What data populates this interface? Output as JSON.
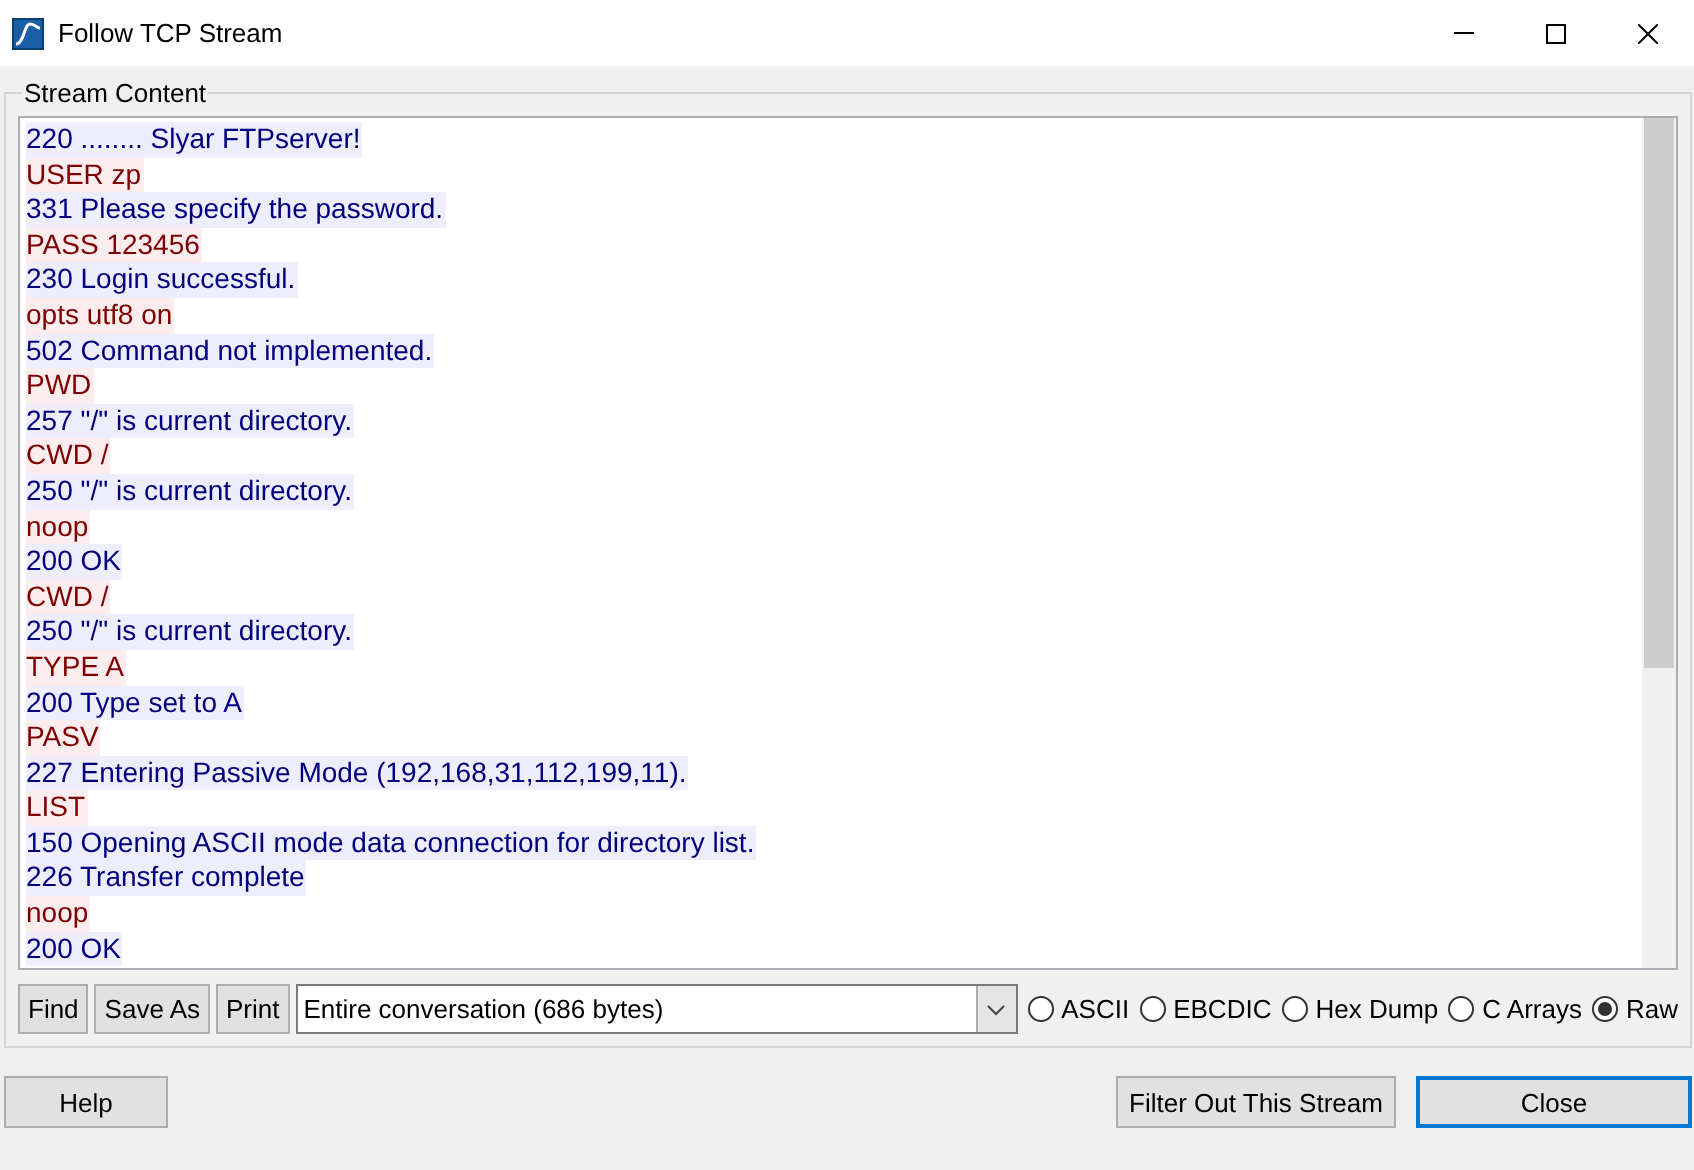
{
  "window": {
    "title": "Follow TCP Stream"
  },
  "stream": {
    "label": "Stream Content",
    "lines": [
      {
        "kind": "server",
        "text": "220 ........ Slyar FTPserver!"
      },
      {
        "kind": "client",
        "text": "USER zp"
      },
      {
        "kind": "server",
        "text": "331 Please specify the password."
      },
      {
        "kind": "client",
        "text": "PASS 123456"
      },
      {
        "kind": "server",
        "text": "230 Login successful."
      },
      {
        "kind": "client",
        "text": "opts utf8 on"
      },
      {
        "kind": "server",
        "text": "502 Command not implemented."
      },
      {
        "kind": "client",
        "text": "PWD"
      },
      {
        "kind": "server",
        "text": "257 \"/\" is current directory."
      },
      {
        "kind": "client",
        "text": "CWD /"
      },
      {
        "kind": "server",
        "text": "250 \"/\" is current directory."
      },
      {
        "kind": "client",
        "text": "noop"
      },
      {
        "kind": "server",
        "text": "200 OK"
      },
      {
        "kind": "client",
        "text": "CWD /"
      },
      {
        "kind": "server",
        "text": "250 \"/\" is current directory."
      },
      {
        "kind": "client",
        "text": "TYPE A"
      },
      {
        "kind": "server",
        "text": "200 Type set to A"
      },
      {
        "kind": "client",
        "text": "PASV"
      },
      {
        "kind": "server",
        "text": "227 Entering Passive Mode (192,168,31,112,199,11)."
      },
      {
        "kind": "client",
        "text": "LIST"
      },
      {
        "kind": "server",
        "text": "150 Opening ASCII mode data connection for directory list."
      },
      {
        "kind": "server",
        "text": "226 Transfer complete"
      },
      {
        "kind": "client",
        "text": "noop"
      },
      {
        "kind": "server",
        "text": "200 OK"
      }
    ]
  },
  "toolbar": {
    "buttons": [
      "Find",
      "Save As",
      "Print"
    ],
    "conversation": "Entire conversation (686 bytes)",
    "formats": [
      {
        "label": "ASCII",
        "selected": false
      },
      {
        "label": "EBCDIC",
        "selected": false
      },
      {
        "label": "Hex Dump",
        "selected": false
      },
      {
        "label": "C Arrays",
        "selected": false
      },
      {
        "label": "Raw",
        "selected": true
      }
    ]
  },
  "footer": {
    "help": "Help",
    "filter": "Filter Out This Stream",
    "close": "Close"
  }
}
